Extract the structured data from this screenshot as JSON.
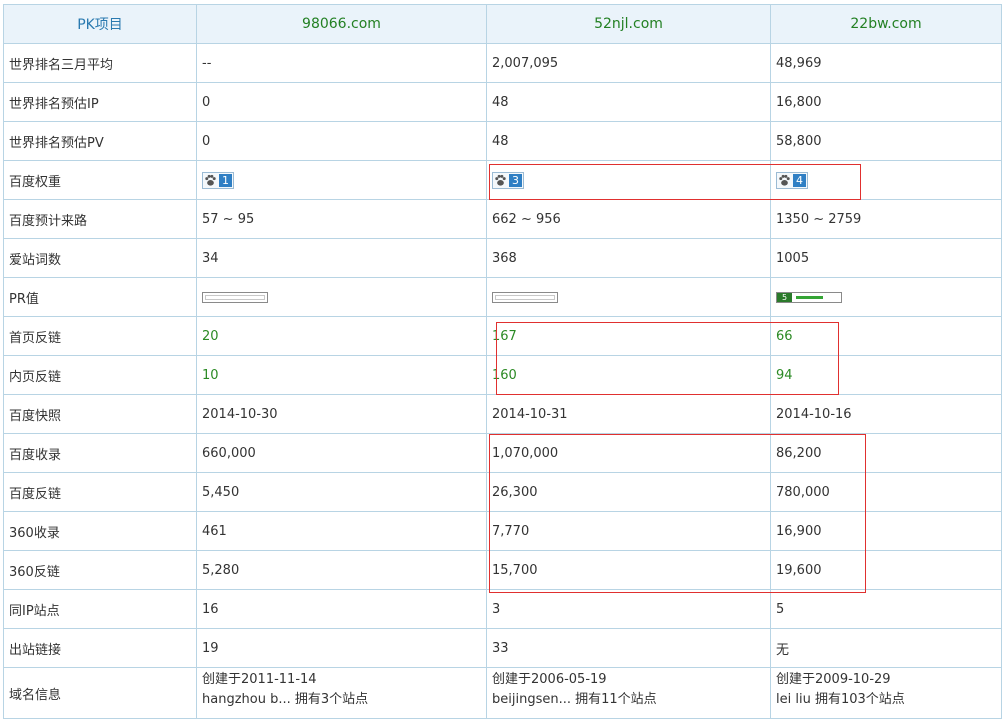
{
  "header": {
    "col0": "PK项目",
    "sites": [
      "98066.com",
      "52njl.com",
      "22bw.com"
    ]
  },
  "rows": [
    {
      "label": "世界排名三月平均",
      "values": [
        "--",
        "2,007,095",
        "48,969"
      ]
    },
    {
      "label": "世界排名预估IP",
      "values": [
        "0",
        "48",
        "16,800"
      ]
    },
    {
      "label": "世界排名预估PV",
      "values": [
        "0",
        "48",
        "58,800"
      ]
    },
    {
      "label": "百度权重",
      "values": [
        "1",
        "3",
        "4"
      ]
    },
    {
      "label": "百度预计来路",
      "values": [
        "57 ~ 95",
        "662 ~ 956",
        "1350 ~ 2759"
      ]
    },
    {
      "label": "爱站词数",
      "values": [
        "34",
        "368",
        "1005"
      ]
    },
    {
      "label": "PR值",
      "values": [
        "",
        "",
        "5"
      ]
    },
    {
      "label": "首页反链",
      "values": [
        "20",
        "167",
        "66"
      ]
    },
    {
      "label": "内页反链",
      "values": [
        "10",
        "160",
        "94"
      ]
    },
    {
      "label": "百度快照",
      "values": [
        "2014-10-30",
        "2014-10-31",
        "2014-10-16"
      ]
    },
    {
      "label": "百度收录",
      "values": [
        "660,000",
        "1,070,000",
        "86,200"
      ]
    },
    {
      "label": "百度反链",
      "values": [
        "5,450",
        "26,300",
        "780,000"
      ]
    },
    {
      "label": "360收录",
      "values": [
        "461",
        "7,770",
        "16,900"
      ]
    },
    {
      "label": "360反链",
      "values": [
        "5,280",
        "15,700",
        "19,600"
      ]
    },
    {
      "label": "同IP站点",
      "values": [
        "16",
        "3",
        "5"
      ]
    },
    {
      "label": "出站链接",
      "values": [
        "19",
        "33",
        "无"
      ]
    }
  ],
  "domain_info": {
    "label": "域名信息",
    "values": [
      {
        "created": "创建于2011-11-14",
        "owner": "hangzhou b... 拥有3个站点"
      },
      {
        "created": "创建于2006-05-19",
        "owner": "beijingsen... 拥有11个站点"
      },
      {
        "created": "创建于2009-10-29",
        "owner": "lei liu 拥有103个站点"
      }
    ]
  },
  "pr_values": [
    0,
    0,
    0.45
  ],
  "colors": {
    "link_green": "#2b8a24",
    "header_blue": "#2a7ab0",
    "highlight_red": "#e0302f"
  }
}
